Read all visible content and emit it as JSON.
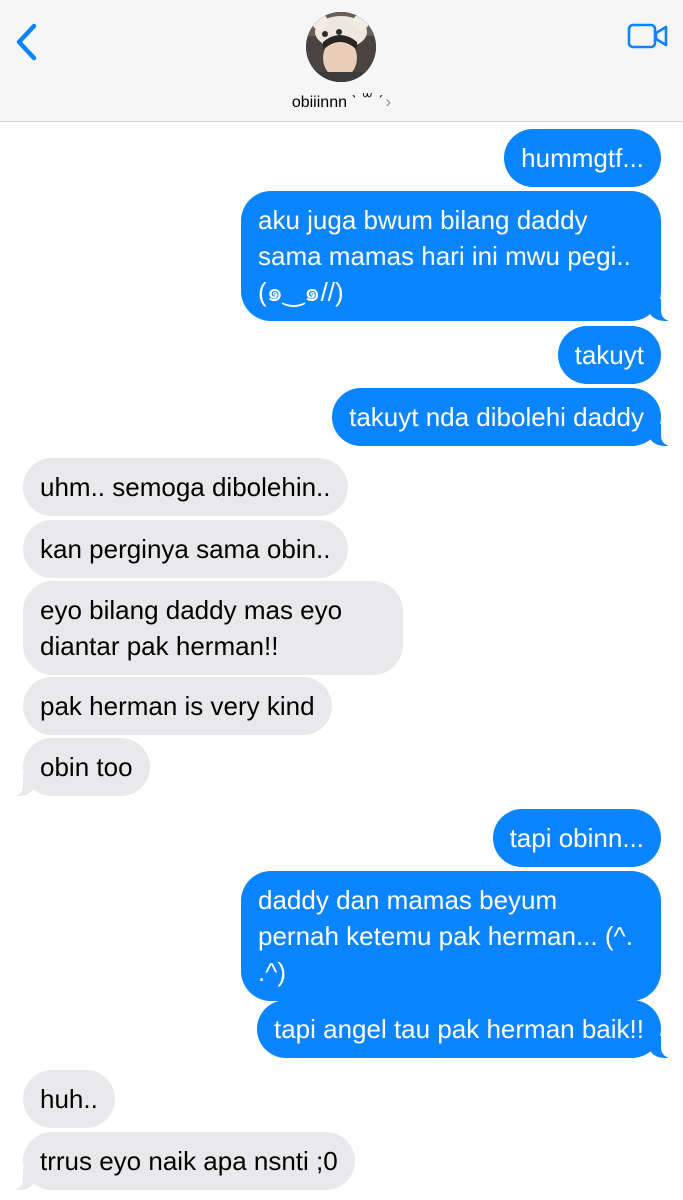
{
  "header": {
    "contact_name": "obiiinnn ˋ ꒳ ˊ",
    "chevron": "›",
    "back_icon": "chevron-left-icon",
    "video_icon": "video-camera-icon",
    "accent": "#0a84ff"
  },
  "messages": [
    {
      "dir": "out",
      "text": "hummgtf..."
    },
    {
      "dir": "out",
      "text": "aku juga bwum bilang daddy sama mamas hari ini mwu pegi.. (๑‿๑//)"
    },
    {
      "dir": "out",
      "text": "takuyt"
    },
    {
      "dir": "out",
      "text": "takuyt nda dibolehi daddy"
    },
    {
      "dir": "in",
      "text": "uhm.. semoga dibolehin.."
    },
    {
      "dir": "in",
      "text": "kan perginya sama obin.."
    },
    {
      "dir": "in",
      "text": "eyo bilang daddy mas eyo diantar pak herman!!"
    },
    {
      "dir": "in",
      "text": "pak herman is very kind"
    },
    {
      "dir": "in",
      "text": "obin too"
    },
    {
      "dir": "out",
      "text": "tapi obinn..."
    },
    {
      "dir": "out",
      "text": "daddy dan mamas beyum pernah ketemu pak herman... (^. .^)"
    },
    {
      "dir": "out",
      "text": "tapi angel tau pak herman baik!!"
    },
    {
      "dir": "in",
      "text": "huh.."
    },
    {
      "dir": "in",
      "text": "trrus eyo naik apa nsnti ;0"
    }
  ],
  "colors": {
    "outgoing_bubble": "#0a84ff",
    "incoming_bubble": "#e9e9eb",
    "header_bg": "#f6f6f6"
  }
}
